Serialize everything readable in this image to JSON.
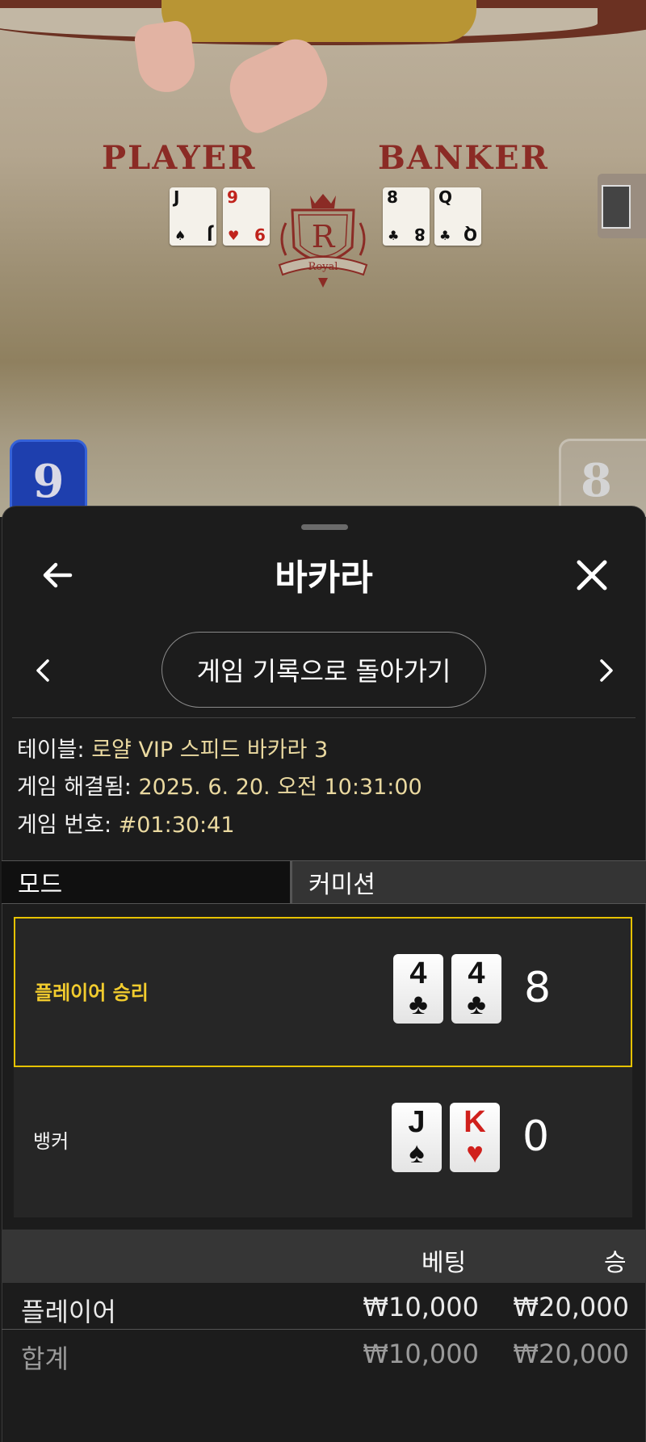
{
  "table_video": {
    "player_label": "PLAYER",
    "banker_label": "BANKER",
    "crest_letter": "R",
    "crest_text": "Royal",
    "player_score": "9",
    "banker_score": "8",
    "player_cards": [
      {
        "rank": "J",
        "suit": "♠",
        "color": "#111111"
      },
      {
        "rank": "9",
        "suit": "♥",
        "color": "#c0231c"
      }
    ],
    "banker_cards": [
      {
        "rank": "8",
        "suit": "♣",
        "color": "#111111"
      },
      {
        "rank": "Q",
        "suit": "♣",
        "color": "#111111"
      }
    ]
  },
  "header": {
    "title": "바카라",
    "back_icon": "arrow-left-icon",
    "close_icon": "close-icon"
  },
  "nav": {
    "back_to_history": "게임 기록으로 돌아가기",
    "prev_icon": "chevron-left-icon",
    "next_icon": "chevron-right-icon"
  },
  "info": {
    "table_key": "테이블: ",
    "table_value": "로얄 VIP 스피드 바카라 3",
    "resolved_key": "게임 해결됨: ",
    "resolved_value": "2025. 6. 20. 오전 10:31:00",
    "game_no_key": "게임 번호: ",
    "game_no_value": "#01:30:41"
  },
  "tabs": {
    "mode": "모드",
    "commission": "커미션"
  },
  "results": [
    {
      "label": "플레이어 승리",
      "winner": true,
      "cards": [
        {
          "rank": "4",
          "suit": "♣",
          "color": "#111111"
        },
        {
          "rank": "4",
          "suit": "♣",
          "color": "#111111"
        }
      ],
      "total": "8"
    },
    {
      "label": "뱅커",
      "winner": false,
      "cards": [
        {
          "rank": "J",
          "suit": "♠",
          "color": "#111111"
        },
        {
          "rank": "K",
          "suit": "♥",
          "color": "#d0201c"
        }
      ],
      "total": "0"
    }
  ],
  "bets": {
    "headers": {
      "bet": "베팅",
      "win": "승"
    },
    "rows": [
      {
        "name": "플레이어",
        "bet": "₩10,000",
        "win": "₩20,000"
      }
    ],
    "total": {
      "name": "합계",
      "bet": "₩10,000",
      "win": "₩20,000"
    }
  },
  "colors": {
    "accent_gold": "#e6c200",
    "winner_label": "#f2cc2e",
    "info_value": "#ead9a0",
    "player_score_bg": "#1e3fae",
    "felt_text": "#8b2b25"
  }
}
